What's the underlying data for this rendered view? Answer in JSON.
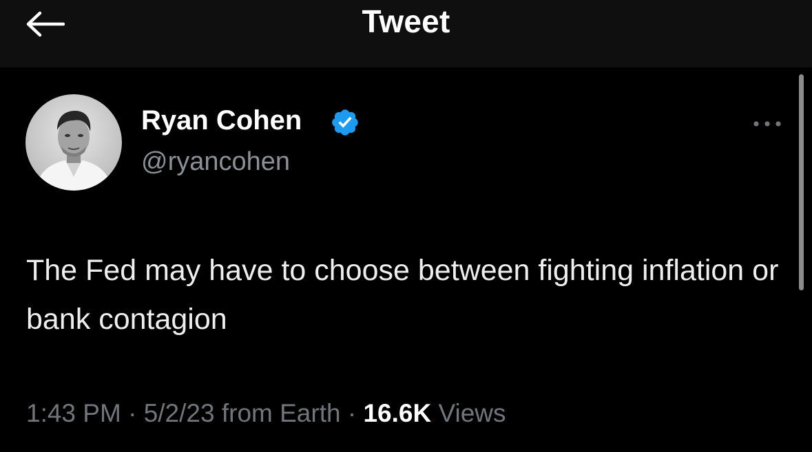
{
  "header": {
    "title": "Tweet",
    "back_icon": "arrow-left-icon"
  },
  "tweet": {
    "author": {
      "name": "Ryan Cohen",
      "handle": "@ryancohen",
      "verified": true,
      "verified_icon": "verified-badge-icon"
    },
    "more_icon": "ellipsis-icon",
    "text": "The Fed may have to choose between fighting inflation or bank contagion",
    "meta": {
      "time": "1:43 PM",
      "separator": "·",
      "date": "5/2/23",
      "source": "from Earth",
      "views_count": "16.6K",
      "views_label": "Views"
    }
  },
  "colors": {
    "background": "#000000",
    "header_background": "#0f0f10",
    "primary_text": "#ffffff",
    "secondary_text": "#71767b",
    "verified_blue": "#1d9bf0"
  }
}
